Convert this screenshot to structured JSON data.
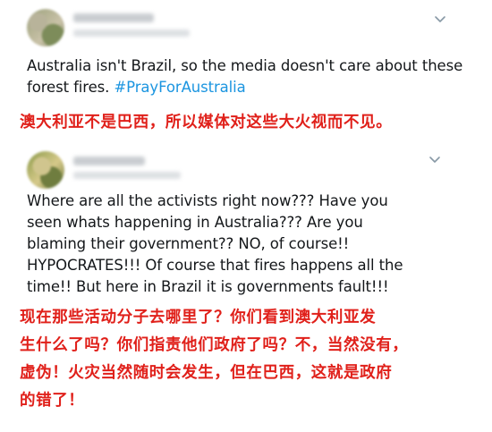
{
  "tweets": [
    {
      "text": "Australia isn't Brazil, so the media doesn't care about these forest fires. ",
      "hashtag": "#PrayForAustralia",
      "translation": "澳大利亚不是巴西，所以媒体对这些大火视而不见。"
    },
    {
      "text_lines": [
        "Where are all the activists right now??? Have you",
        "seen whats happening in Australia??? Are you",
        "blaming their government?? NO, of course!!",
        "HYPOCRATES!!! Of course that fires happens all the",
        "time!! But here in Brazil it is governments fault!!!"
      ],
      "translation_lines": [
        "现在那些活动分子去哪里了？你们看到澳大利亚发",
        "生什么了吗？你们指责他们政府了吗？不，当然没有，",
        "虚伪！火灾当然随时会发生，但在巴西，这就是政府",
        "的错了！"
      ]
    }
  ],
  "icons": {
    "menu": "chevron-down-icon"
  },
  "colors": {
    "hashtag": "#1b95e0",
    "translation": "#e0201a",
    "text": "#14171a",
    "icon": "#8899a6"
  }
}
